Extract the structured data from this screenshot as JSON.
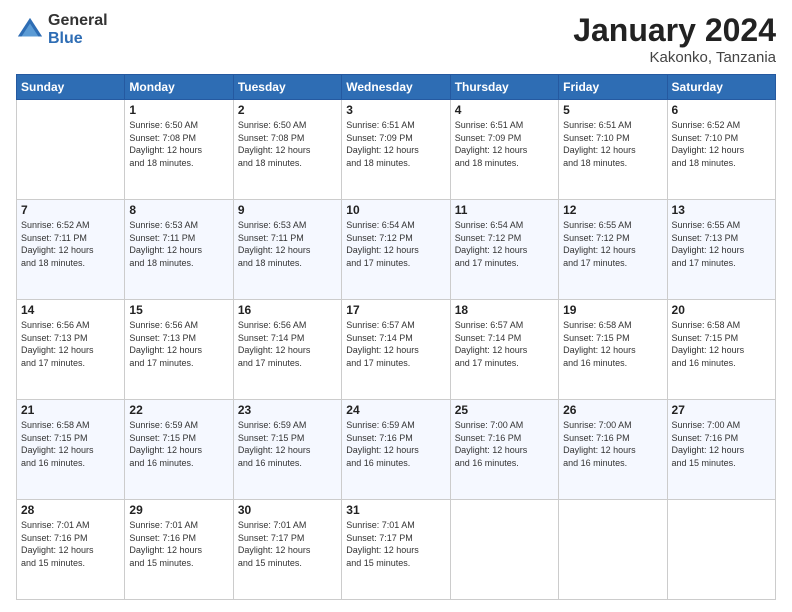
{
  "header": {
    "logo_general": "General",
    "logo_blue": "Blue",
    "title": "January 2024",
    "location": "Kakonko, Tanzania"
  },
  "calendar": {
    "days_of_week": [
      "Sunday",
      "Monday",
      "Tuesday",
      "Wednesday",
      "Thursday",
      "Friday",
      "Saturday"
    ],
    "weeks": [
      [
        {
          "day": "",
          "info": ""
        },
        {
          "day": "1",
          "info": "Sunrise: 6:50 AM\nSunset: 7:08 PM\nDaylight: 12 hours\nand 18 minutes."
        },
        {
          "day": "2",
          "info": "Sunrise: 6:50 AM\nSunset: 7:08 PM\nDaylight: 12 hours\nand 18 minutes."
        },
        {
          "day": "3",
          "info": "Sunrise: 6:51 AM\nSunset: 7:09 PM\nDaylight: 12 hours\nand 18 minutes."
        },
        {
          "day": "4",
          "info": "Sunrise: 6:51 AM\nSunset: 7:09 PM\nDaylight: 12 hours\nand 18 minutes."
        },
        {
          "day": "5",
          "info": "Sunrise: 6:51 AM\nSunset: 7:10 PM\nDaylight: 12 hours\nand 18 minutes."
        },
        {
          "day": "6",
          "info": "Sunrise: 6:52 AM\nSunset: 7:10 PM\nDaylight: 12 hours\nand 18 minutes."
        }
      ],
      [
        {
          "day": "7",
          "info": ""
        },
        {
          "day": "8",
          "info": "Sunrise: 6:53 AM\nSunset: 7:11 PM\nDaylight: 12 hours\nand 18 minutes."
        },
        {
          "day": "9",
          "info": "Sunrise: 6:53 AM\nSunset: 7:11 PM\nDaylight: 12 hours\nand 18 minutes."
        },
        {
          "day": "10",
          "info": "Sunrise: 6:54 AM\nSunset: 7:12 PM\nDaylight: 12 hours\nand 17 minutes."
        },
        {
          "day": "11",
          "info": "Sunrise: 6:54 AM\nSunset: 7:12 PM\nDaylight: 12 hours\nand 17 minutes."
        },
        {
          "day": "12",
          "info": "Sunrise: 6:55 AM\nSunset: 7:12 PM\nDaylight: 12 hours\nand 17 minutes."
        },
        {
          "day": "13",
          "info": "Sunrise: 6:55 AM\nSunset: 7:13 PM\nDaylight: 12 hours\nand 17 minutes."
        }
      ],
      [
        {
          "day": "14",
          "info": ""
        },
        {
          "day": "15",
          "info": "Sunrise: 6:56 AM\nSunset: 7:13 PM\nDaylight: 12 hours\nand 17 minutes."
        },
        {
          "day": "16",
          "info": "Sunrise: 6:56 AM\nSunset: 7:14 PM\nDaylight: 12 hours\nand 17 minutes."
        },
        {
          "day": "17",
          "info": "Sunrise: 6:57 AM\nSunset: 7:14 PM\nDaylight: 12 hours\nand 17 minutes."
        },
        {
          "day": "18",
          "info": "Sunrise: 6:57 AM\nSunset: 7:14 PM\nDaylight: 12 hours\nand 17 minutes."
        },
        {
          "day": "19",
          "info": "Sunrise: 6:58 AM\nSunset: 7:15 PM\nDaylight: 12 hours\nand 16 minutes."
        },
        {
          "day": "20",
          "info": "Sunrise: 6:58 AM\nSunset: 7:15 PM\nDaylight: 12 hours\nand 16 minutes."
        }
      ],
      [
        {
          "day": "21",
          "info": ""
        },
        {
          "day": "22",
          "info": "Sunrise: 6:59 AM\nSunset: 7:15 PM\nDaylight: 12 hours\nand 16 minutes."
        },
        {
          "day": "23",
          "info": "Sunrise: 6:59 AM\nSunset: 7:15 PM\nDaylight: 12 hours\nand 16 minutes."
        },
        {
          "day": "24",
          "info": "Sunrise: 6:59 AM\nSunset: 7:16 PM\nDaylight: 12 hours\nand 16 minutes."
        },
        {
          "day": "25",
          "info": "Sunrise: 7:00 AM\nSunset: 7:16 PM\nDaylight: 12 hours\nand 16 minutes."
        },
        {
          "day": "26",
          "info": "Sunrise: 7:00 AM\nSunset: 7:16 PM\nDaylight: 12 hours\nand 16 minutes."
        },
        {
          "day": "27",
          "info": "Sunrise: 7:00 AM\nSunset: 7:16 PM\nDaylight: 12 hours\nand 15 minutes."
        }
      ],
      [
        {
          "day": "28",
          "info": ""
        },
        {
          "day": "29",
          "info": "Sunrise: 7:01 AM\nSunset: 7:16 PM\nDaylight: 12 hours\nand 15 minutes."
        },
        {
          "day": "30",
          "info": "Sunrise: 7:01 AM\nSunset: 7:17 PM\nDaylight: 12 hours\nand 15 minutes."
        },
        {
          "day": "31",
          "info": "Sunrise: 7:01 AM\nSunset: 7:17 PM\nDaylight: 12 hours\nand 15 minutes."
        },
        {
          "day": "",
          "info": ""
        },
        {
          "day": "",
          "info": ""
        },
        {
          "day": "",
          "info": ""
        }
      ]
    ],
    "week1_day7_info": "Sunrise: 6:52 AM\nSunset: 7:11 PM\nDaylight: 12 hours\nand 18 minutes.",
    "week2_day14_info": "Sunrise: 6:56 AM\nSunset: 7:13 PM\nDaylight: 12 hours\nand 17 minutes.",
    "week3_day21_info": "Sunrise: 6:58 AM\nSunset: 7:15 PM\nDaylight: 12 hours\nand 16 minutes.",
    "week4_day28_info": "Sunrise: 7:01 AM\nSunset: 7:16 PM\nDaylight: 12 hours\nand 15 minutes."
  }
}
